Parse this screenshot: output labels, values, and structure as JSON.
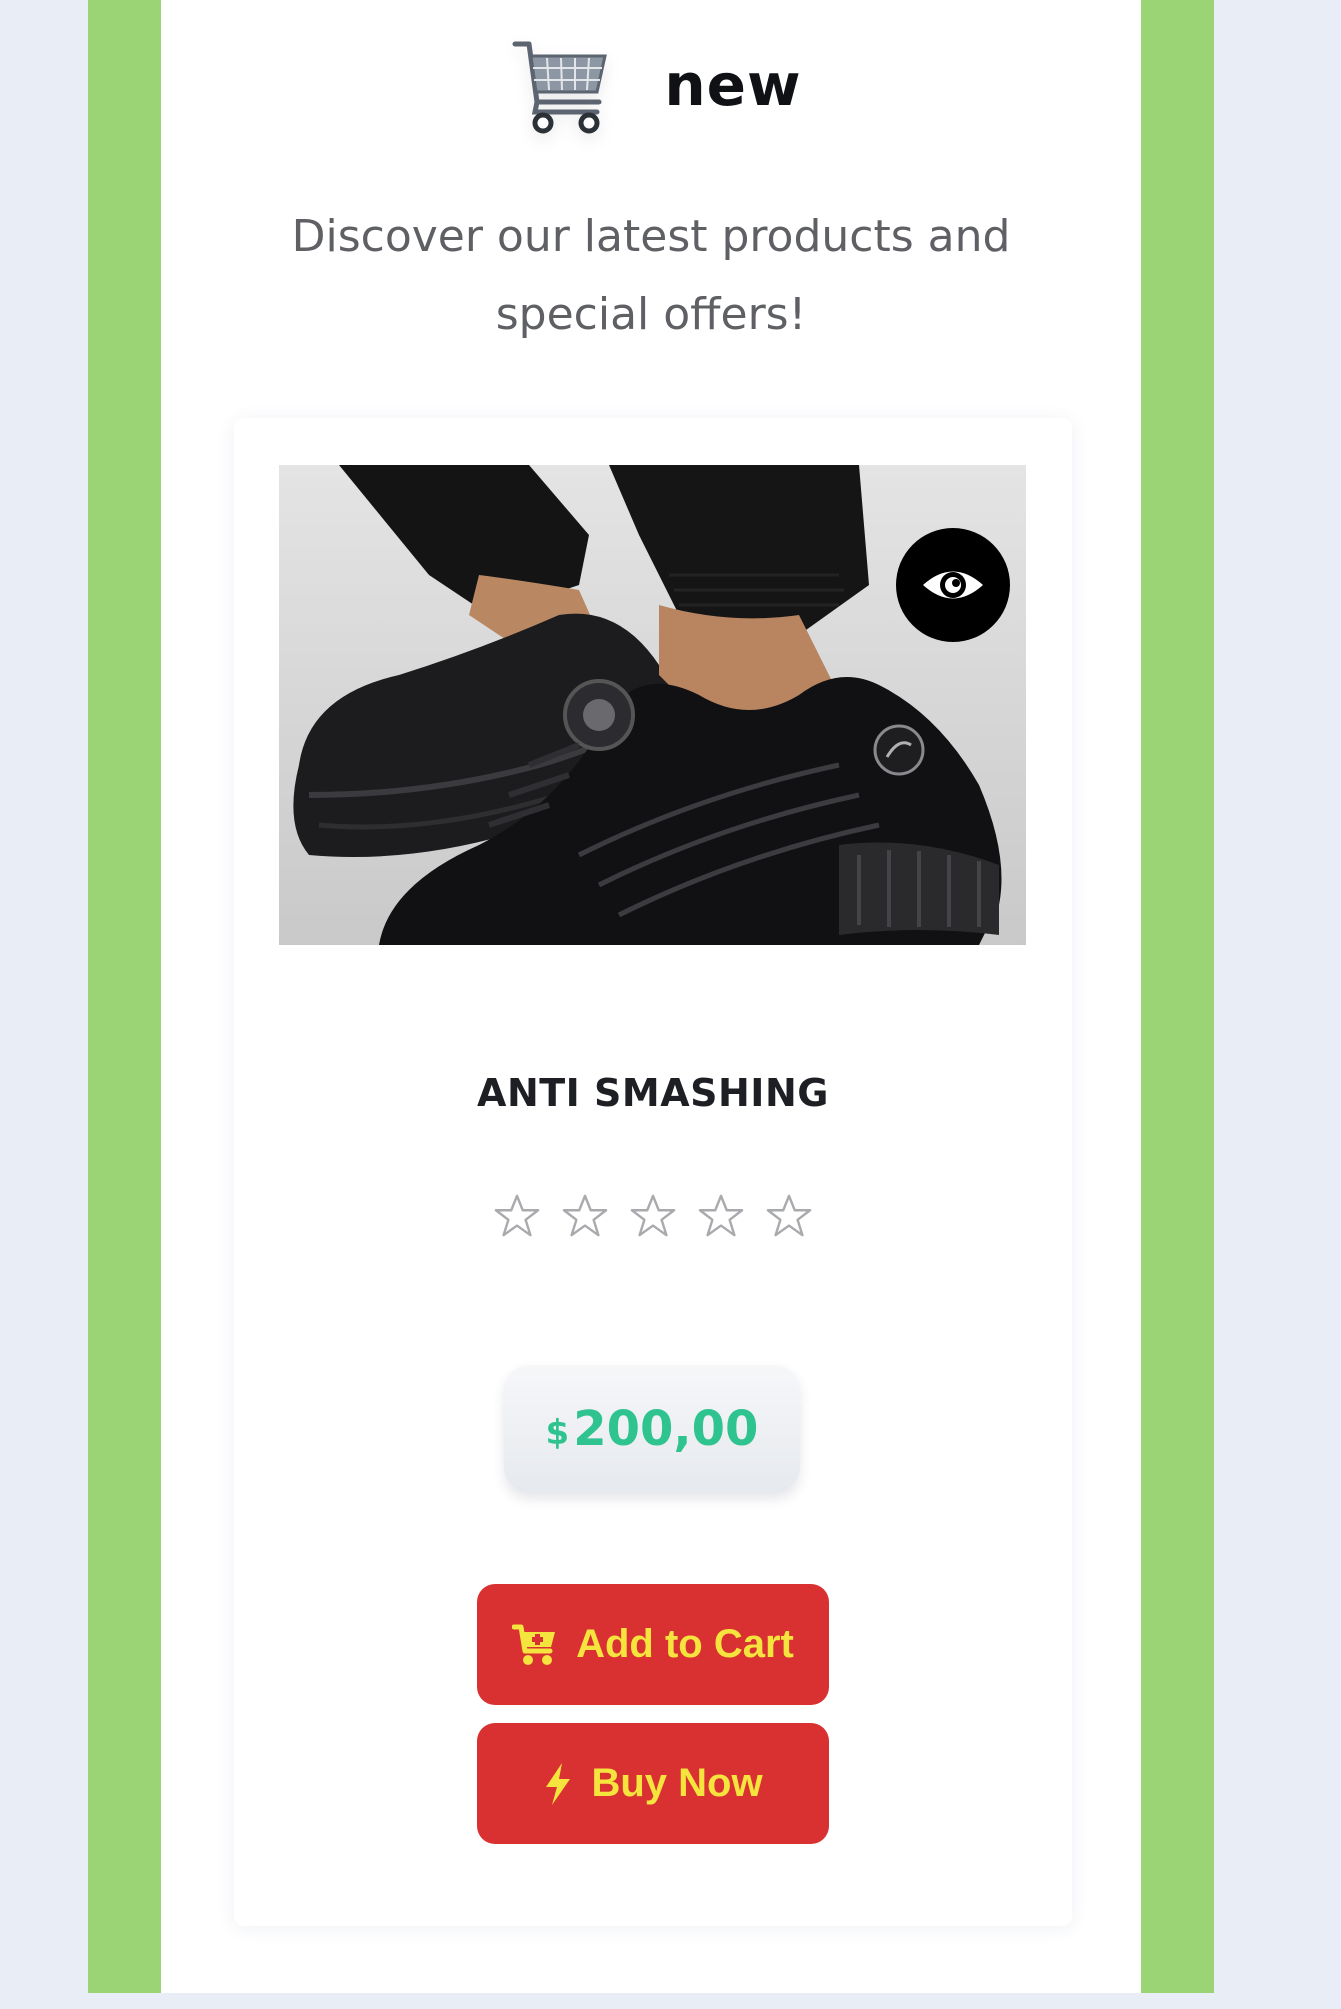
{
  "header": {
    "title": "new",
    "logo_icon": "shopping-cart-icon"
  },
  "subtitle": "Discover our latest products and special offers!",
  "product": {
    "name": "ANTI SMASHING",
    "image_icon": "black-sneaker-photo",
    "quick_view_icon": "eye-icon",
    "rating": {
      "value": 0,
      "max": 5
    },
    "price": {
      "currency": "$",
      "amount": "200,00"
    }
  },
  "actions": {
    "add_to_cart": {
      "label": "Add to Cart",
      "icon": "cart-icon"
    },
    "buy_now": {
      "label": "Buy Now",
      "icon": "lightning-icon"
    }
  },
  "colors": {
    "frame_green": "#9ad474",
    "button_red": "#d93131",
    "button_text_yellow": "#f5e43d",
    "price_green": "#2fc48f",
    "page_background": "#e9edf6"
  }
}
